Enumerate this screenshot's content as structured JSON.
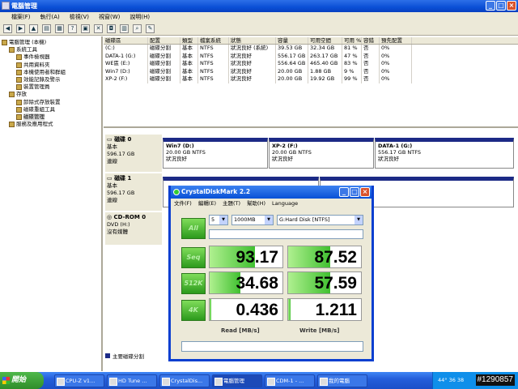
{
  "window": {
    "title": "電腦管理"
  },
  "menu": [
    "檔案(F)",
    "執行(A)",
    "檢視(V)",
    "視窗(W)",
    "說明(H)"
  ],
  "tree": [
    {
      "label": "電腦管理 (本機)",
      "indent": 0
    },
    {
      "label": "系統工具",
      "indent": 1
    },
    {
      "label": "事件檢視器",
      "indent": 2
    },
    {
      "label": "共用資料夾",
      "indent": 2
    },
    {
      "label": "本機使用者和群組",
      "indent": 2
    },
    {
      "label": "效能記錄及警示",
      "indent": 2
    },
    {
      "label": "裝置管理員",
      "indent": 2
    },
    {
      "label": "存放",
      "indent": 1
    },
    {
      "label": "卸除式存放裝置",
      "indent": 2
    },
    {
      "label": "磁碟重組工具",
      "indent": 2
    },
    {
      "label": "磁碟管理",
      "indent": 2,
      "selected": true
    },
    {
      "label": "服務及應用程式",
      "indent": 1
    }
  ],
  "volume_table": {
    "headers": [
      "磁碟區",
      "配置",
      "類型",
      "檔案系統",
      "狀態",
      "容量",
      "可用空間",
      "可用 %",
      "容錯",
      "預先配置"
    ],
    "rows": [
      [
        "(C:)",
        "磁碟分割",
        "基本",
        "NTFS",
        "狀況良好 (系統)",
        "39.53 GB",
        "32.34 GB",
        "81 %",
        "否",
        "0%"
      ],
      [
        "DATA-1 (G:)",
        "磁碟分割",
        "基本",
        "NTFS",
        "狀況良好",
        "556.17 GB",
        "263.17 GB",
        "47 %",
        "否",
        "0%"
      ],
      [
        "WE區 (E:)",
        "磁碟分割",
        "基本",
        "NTFS",
        "狀況良好",
        "556.64 GB",
        "465.40 GB",
        "83 %",
        "否",
        "0%"
      ],
      [
        "Win7 (D:)",
        "磁碟分割",
        "基本",
        "NTFS",
        "狀況良好",
        "20.00 GB",
        "1.88 GB",
        "9 %",
        "否",
        "0%"
      ],
      [
        "XP-2 (F:)",
        "磁碟分割",
        "基本",
        "NTFS",
        "狀況良好",
        "20.00 GB",
        "19.92 GB",
        "99 %",
        "否",
        "0%"
      ]
    ]
  },
  "disks": [
    {
      "name": "磁碟 0",
      "type": "基本",
      "size": "596.17 GB",
      "status": "連線",
      "parts": [
        {
          "name": "Win7  (D:)",
          "size": "20.00 GB NTFS",
          "status": "狀況良好"
        },
        {
          "name": "XP-2  (F:)",
          "size": "20.00 GB NTFS",
          "status": "狀況良好"
        },
        {
          "name": "DATA-1  (G:)",
          "size": "556.17 GB NTFS",
          "status": "狀況良好"
        }
      ]
    },
    {
      "name": "磁碟 1",
      "type": "基本",
      "size": "596.17 GB",
      "status": "連線"
    },
    {
      "name": "CD-ROM 0",
      "type": "DVD (H:)",
      "status": "沒有媒體"
    }
  ],
  "legend": "主要磁碟分割",
  "cdm": {
    "title": "CrystalDiskMark 2.2",
    "menu": [
      "文件(F)",
      "編輯(E)",
      "主題(T)",
      "幫助(H)",
      "Language"
    ],
    "runs": "5",
    "size": "1000MB",
    "drive": "G:Hard Disk [NTFS]",
    "buttons": [
      "All",
      "Seq",
      "512K",
      "4K"
    ],
    "read": [
      "93.17",
      "34.68",
      "0.436"
    ],
    "write": [
      "87.52",
      "57.59",
      "1.211"
    ],
    "read_fill": [
      0.62,
      0.42,
      0.02
    ],
    "write_fill": [
      0.58,
      0.58,
      0.03
    ],
    "read_label": "Read [MB/s]",
    "write_label": "Write [MB/s]"
  },
  "taskbar": {
    "start": "開始",
    "tasks": [
      "CPU-Z v1...",
      "HD Tune ...",
      "CrystalDis...",
      "電腦管理",
      "CDM-1 - ...",
      "我的電腦"
    ],
    "active": 3,
    "tray": "44° 36 38"
  },
  "watermark": "#1290857"
}
